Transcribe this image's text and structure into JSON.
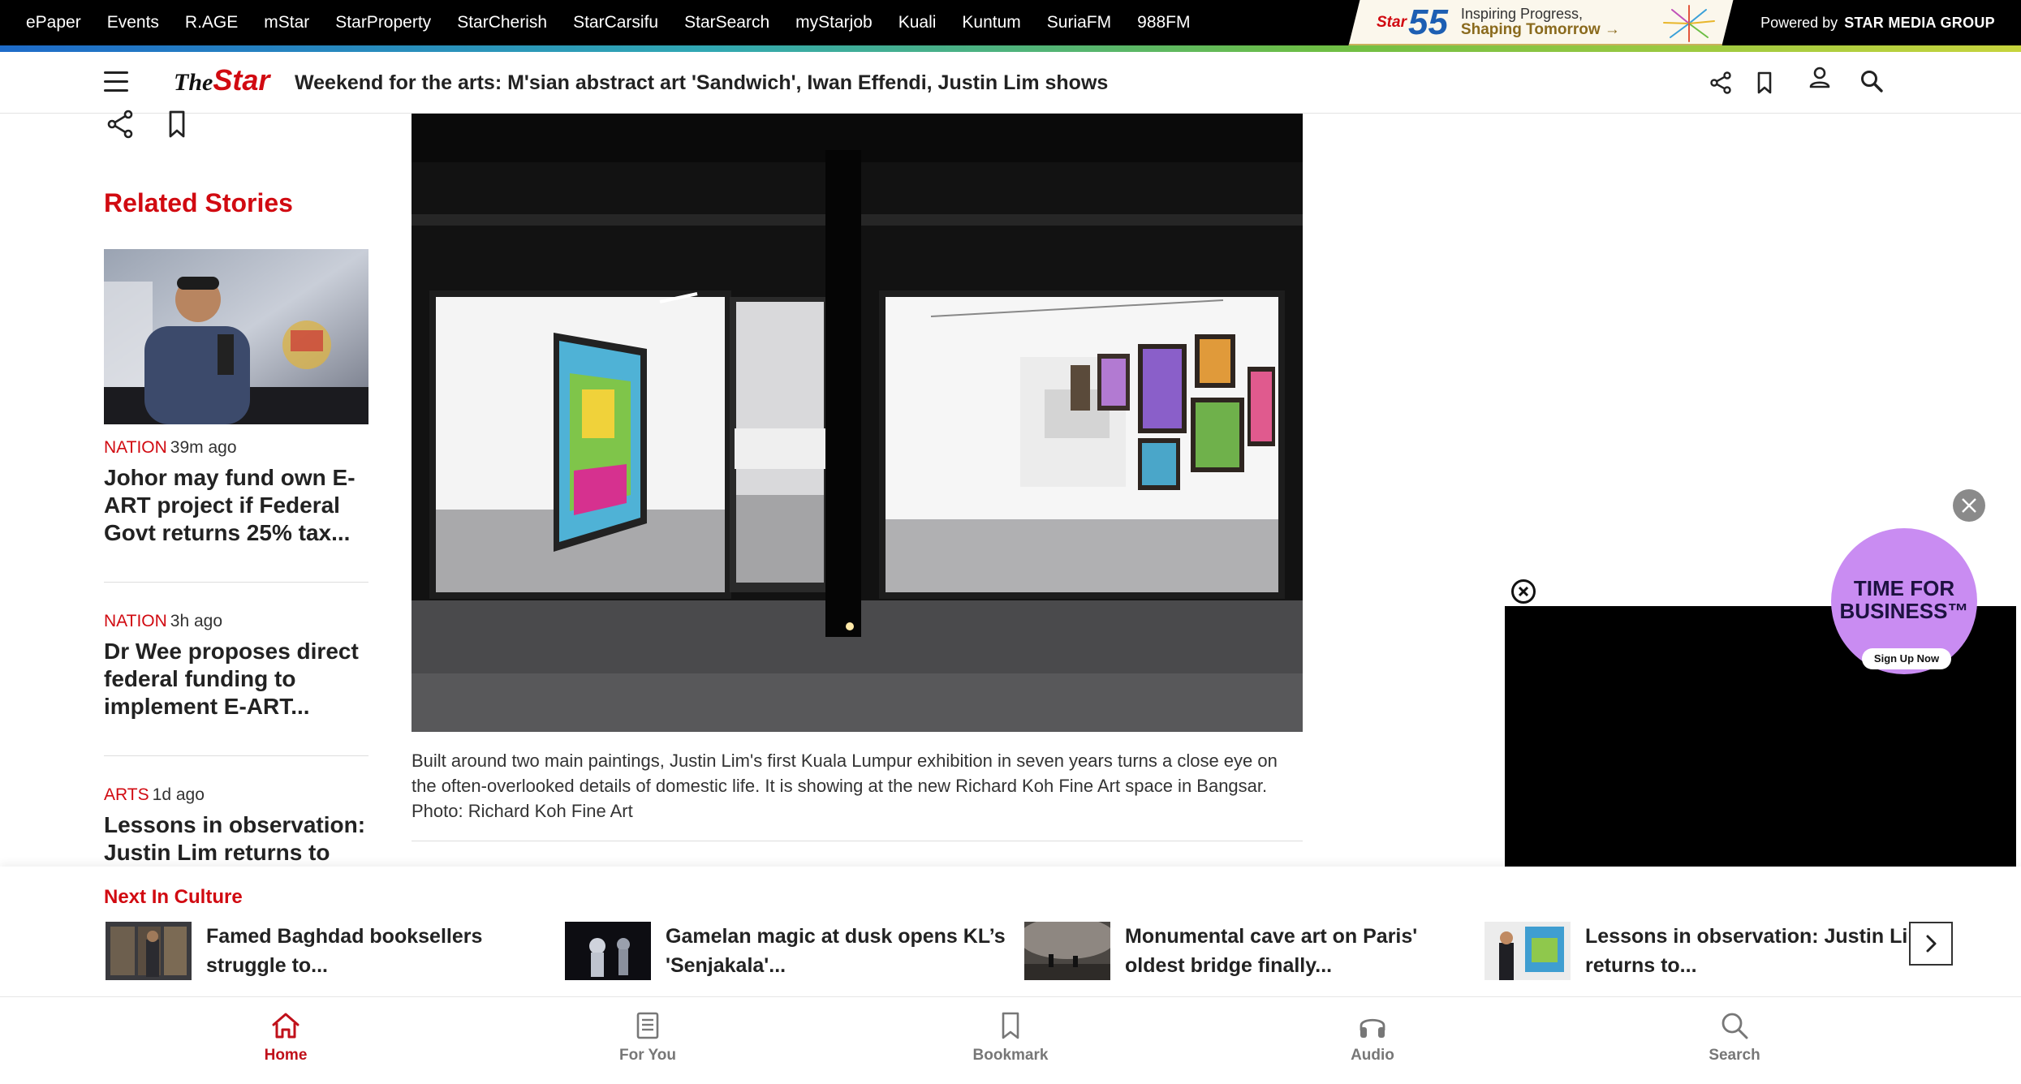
{
  "netbar": {
    "links": [
      "ePaper",
      "Events",
      "R.AGE",
      "mStar",
      "StarProperty",
      "StarCherish",
      "StarCarsifu",
      "StarSearch",
      "myStarjob",
      "Kuali",
      "Kuntum",
      "SuriaFM",
      "988FM"
    ],
    "promo": {
      "logo": "Star",
      "number": "55",
      "line1": "Inspiring Progress,",
      "line2": "Shaping Tomorrow →"
    },
    "powered_prefix": "Powered by",
    "powered_brand": "STAR MEDIA GROUP"
  },
  "header": {
    "logo_the": "The",
    "logo_star": "Star",
    "headline": "Weekend for the arts: M'sian abstract art 'Sandwich', Iwan Effendi, Justin Lim shows"
  },
  "related": {
    "title": "Related Stories",
    "stories": [
      {
        "category": "NATION",
        "time": "39m ago",
        "title": "Johor may fund own E-ART project if Federal Govt returns 25% tax..."
      },
      {
        "category": "NATION",
        "time": "3h ago",
        "title": "Dr Wee proposes direct federal funding to implement E-ART..."
      },
      {
        "category": "ARTS",
        "time": "1d ago",
        "title": "Lessons in observation: Justin Lim returns to KL's"
      }
    ]
  },
  "article": {
    "caption": "Built around two main paintings, Justin Lim's first Kuala Lumpur exhibition in seven years turns a close eye on the often-overlooked details of domestic life. It is showing at the new Richard Koh Fine Art space in Bangsar. Photo: Richard Koh Fine Art"
  },
  "ad": {
    "tfb_line1": "TIME FOR",
    "tfb_line2": "BUSINESS™",
    "tfb_button": "Sign Up Now"
  },
  "next": {
    "title": "Next In Culture",
    "items": [
      {
        "title": "Famed Baghdad booksellers struggle to..."
      },
      {
        "title": "Gamelan magic at dusk opens KL’s 'Senjakala'..."
      },
      {
        "title": "Monumental cave art on Paris' oldest bridge finally..."
      },
      {
        "title": "Lessons in observation: Justin Lim returns to..."
      }
    ]
  },
  "bottom_nav": {
    "items": [
      {
        "label": "Home",
        "icon": "home-icon",
        "active": true
      },
      {
        "label": "For You",
        "icon": "for-you-icon",
        "active": false
      },
      {
        "label": "Bookmark",
        "icon": "bookmark-icon",
        "active": false
      },
      {
        "label": "Audio",
        "icon": "headphones-icon",
        "active": false
      },
      {
        "label": "Search",
        "icon": "search-icon",
        "active": false
      }
    ]
  },
  "colors": {
    "brand_red": "#d10a11",
    "black_bar": "#000000",
    "purple_ad": "#c98cf2"
  }
}
